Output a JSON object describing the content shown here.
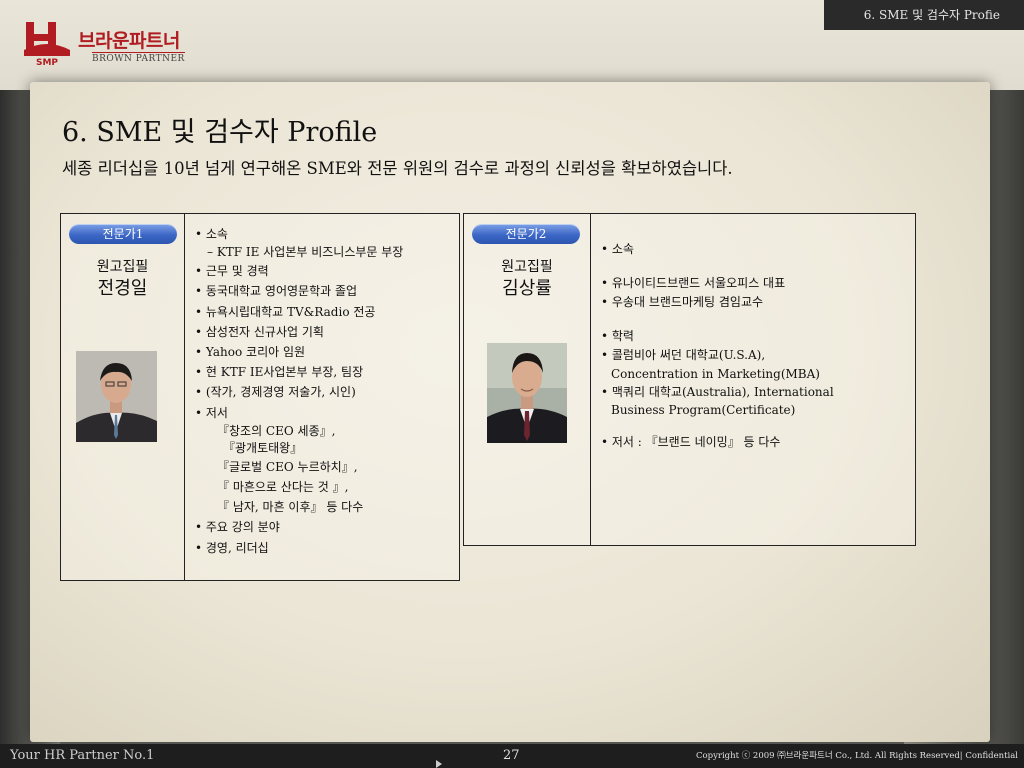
{
  "header": {
    "section_label": "6. SME 및 검수자 Profie",
    "logo_kr": "브라운파트너",
    "logo_en": "BROWN PARTNER"
  },
  "slide": {
    "title": "6. SME 및 검수자 Profile",
    "subtitle": "세종 리더십을 10년 넘게 연구해온 SME와 전문 위원의 검수로 과정의 신뢰성을 확보하였습니다."
  },
  "experts": [
    {
      "badge": "전문가1",
      "role": "원고집필",
      "name": "전경일",
      "items": [
        "• 소속",
        "– KTF IE 사업본부 비즈니스부문 부장",
        "• 근무 및 경력",
        "• 동국대학교 영어영문학과 졸업",
        "• 뉴욕시립대학교 TV&Radio 전공",
        "• 삼성전자 신규사업 기획",
        "• Yahoo 코리아 임원",
        "• 현 KTF IE사업본부 부장, 팀장",
        "• (작가, 경제경영 저술가, 시인)",
        "• 저서",
        "『창조의 CEO 세종』,",
        "『광개토태왕』",
        "『글로벌 CEO 누르하치』,",
        "『 마흔으로 산다는 것 』,",
        "『 남자, 마흔 이후』 등 다수",
        "• 주요 강의 분야",
        "• 경영, 리더십"
      ]
    },
    {
      "badge": "전문가2",
      "role": "원고집필",
      "name": "김상률",
      "items": [
        "• 소속",
        "• 유나이티드브랜드 서울오피스 대표",
        "• 우송대 브랜드마케팅 겸임교수",
        "• 학력",
        "• 콜럼비아 써던 대학교(U.S.A),",
        "Concentration in Marketing(MBA)",
        "• 맥쿼리 대학교(Australia), International",
        "Business Program(Certificate)",
        "• 저서 : 『브랜드 네이밍』 등 다수"
      ]
    }
  ],
  "footer": {
    "tagline": "Your HR Partner No.1",
    "page": "27",
    "copyright": "Copyright ⓒ 2009 ㈜브라운파트너 Co., Ltd. All Rights Reserved| Confidential"
  }
}
